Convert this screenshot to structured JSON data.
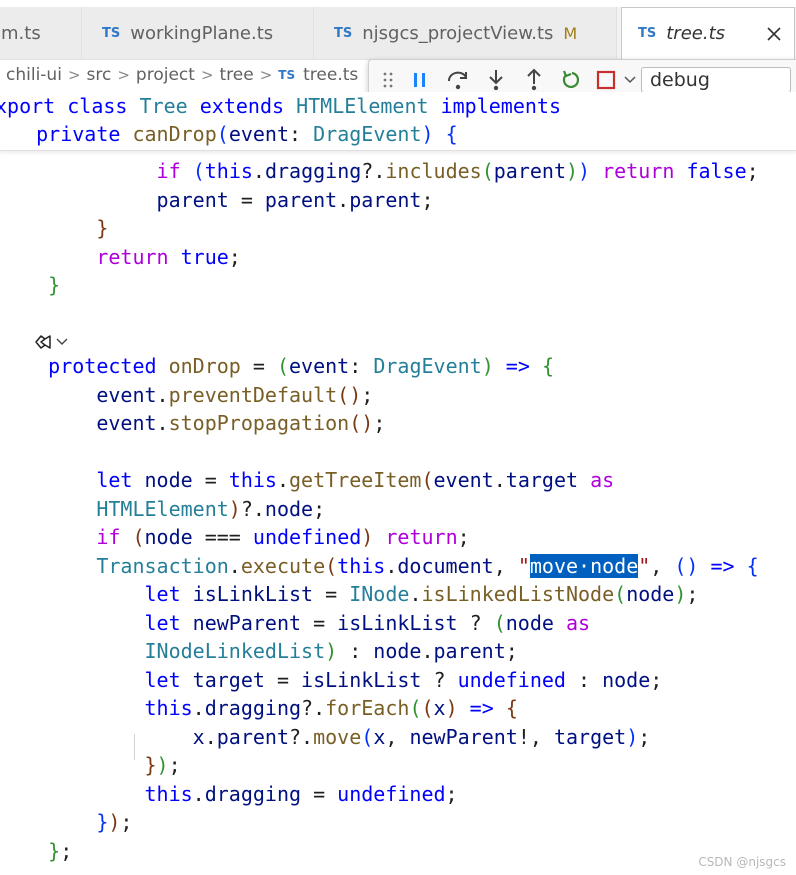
{
  "tabs": [
    {
      "name": "lm.ts",
      "badge": "",
      "modified": "",
      "active": false
    },
    {
      "name": "workingPlane.ts",
      "badge": "TS",
      "modified": "",
      "active": false
    },
    {
      "name": "njsgcs_projectView.ts",
      "badge": "TS",
      "modified": "M",
      "active": false
    },
    {
      "name": "tree.ts",
      "badge": "TS",
      "modified": "",
      "active": true
    }
  ],
  "breadcrumb": {
    "segments": [
      "chili-ui",
      "src",
      "project",
      "tree"
    ],
    "file_badge": "TS",
    "file": "tree.ts"
  },
  "debug": {
    "config_value": "debug",
    "icons": [
      "gripper-icon",
      "pause-icon",
      "step-over-icon",
      "step-into-icon",
      "step-out-icon",
      "restart-icon",
      "stop-icon",
      "chevron-down-icon"
    ]
  },
  "watermark": "CSDN @njsgcs",
  "code": {
    "sticky": [
      "xport class Tree extends HTMLElement implements",
      "  private canDrop(event: DragEvent) {"
    ],
    "selected_text": "move·node",
    "line_count": 25
  }
}
